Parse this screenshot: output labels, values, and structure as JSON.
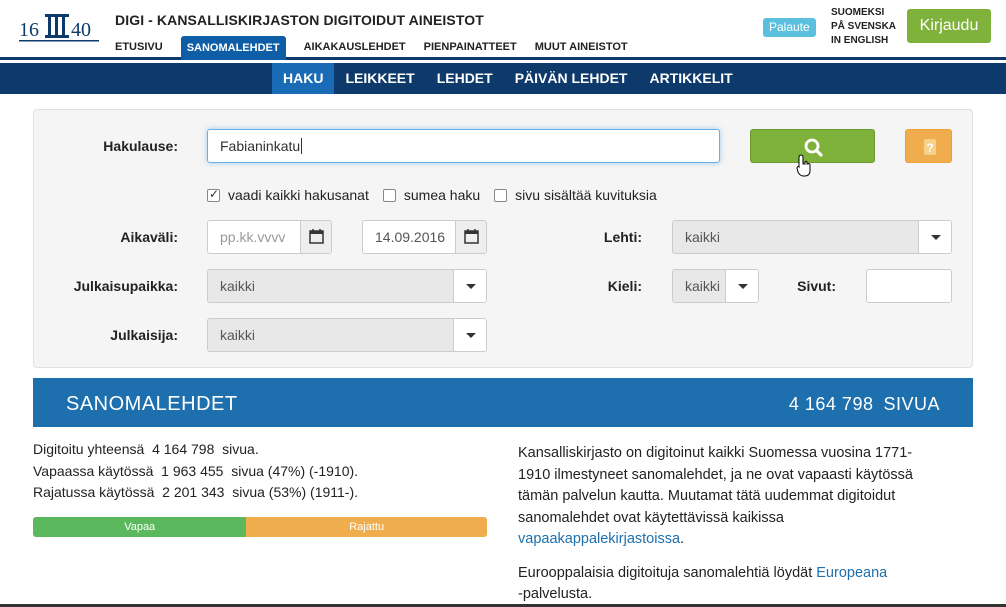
{
  "header": {
    "logo_text": "1640",
    "site_title": "DIGI - KANSALLISKIRJASTON DIGITOIDUT AINEISTOT",
    "nav": [
      "ETUSIVU",
      "SANOMALEHDET",
      "AIKAKAUSLEHDET",
      "PIENPAINATTEET",
      "MUUT AINEISTOT"
    ],
    "nav_active": "SANOMALEHDET",
    "feedback_label": "Palaute",
    "languages": [
      "SUOMEKSI",
      "PÅ SVENSKA",
      "IN ENGLISH"
    ],
    "login_label": "Kirjaudu"
  },
  "subnav": {
    "items": [
      "HAKU",
      "LEIKKEET",
      "LEHDET",
      "PÄIVÄN LEHDET",
      "ARTIKKELIT"
    ],
    "active": "HAKU"
  },
  "search": {
    "query_label": "Hakulause:",
    "query_value": "Fabianinkatu",
    "checkboxes": [
      {
        "label": "vaadi kaikki hakusanat",
        "checked": true
      },
      {
        "label": "sumea haku",
        "checked": false
      },
      {
        "label": "sivu sisältää kuvituksia",
        "checked": false
      }
    ],
    "date_label": "Aikaväli:",
    "date_start_placeholder": "pp.kk.vvvv",
    "date_end_value": "14.09.2016",
    "paper_label": "Lehti:",
    "paper_value": "kaikki",
    "place_label": "Julkaisupaikka:",
    "place_value": "kaikki",
    "language_label": "Kieli:",
    "language_value": "kaikki",
    "pages_label": "Sivut:",
    "pages_value": "",
    "publisher_label": "Julkaisija:",
    "publisher_value": "kaikki"
  },
  "banner": {
    "title": "SANOMALEHDET",
    "count": "4 164 798",
    "unit": "SIVUA"
  },
  "stats": {
    "total": "Digitoitu yhteensä  4 164 798  sivua.",
    "free": "Vapaassa käytössä  1 963 455  sivua (47%) (-1910).",
    "restricted": "Rajatussa käytössä  2 201 343  sivua (53%) (1911-).",
    "bar": [
      {
        "label": "Vapaa",
        "fraction": 0.47,
        "color": "#5cb85c"
      },
      {
        "label": "Rajattu",
        "fraction": 0.53,
        "color": "#f0ad4e"
      }
    ]
  },
  "description": {
    "p1_text": "Kansalliskirjasto on digitoinut kaikki Suomessa vuosina 1771-1910 ilmestyneet sanomalehdet, ja ne ovat vapaasti käytössä tämän palvelun kautta. Muutamat tätä uudemmat digitoidut sanomalehdet ovat käytettävissä kaikissa ",
    "p1_link": "vapaakappalekirjastoissa",
    "p1_end": ".",
    "p2_text": "Eurooppalaisia digitoituja sanomalehtiä löydät ",
    "p2_link": "Europeana",
    "p2_end": " -palvelusta."
  }
}
